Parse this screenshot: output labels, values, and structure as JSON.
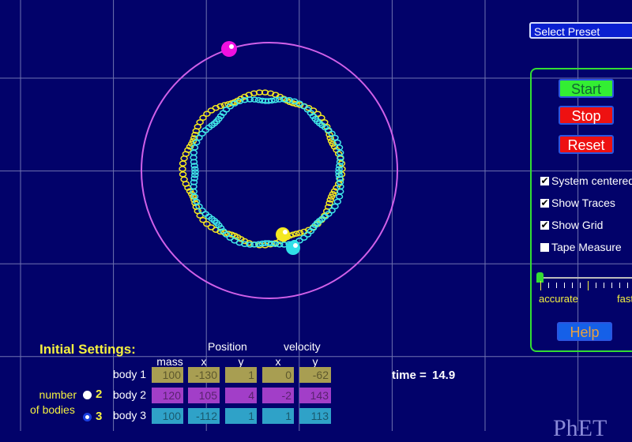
{
  "preset": {
    "label": "Select Preset"
  },
  "controls": {
    "start": "Start",
    "stop": "Stop",
    "reset": "Reset",
    "help": "Help",
    "checkboxes": [
      {
        "label": "System centered",
        "checked": true
      },
      {
        "label": "Show Traces",
        "checked": true
      },
      {
        "label": "Show Grid",
        "checked": true
      },
      {
        "label": "Tape Measure",
        "checked": false
      }
    ],
    "slider": {
      "min_label": "accurate",
      "max_label": "fast",
      "value": 0
    }
  },
  "settings": {
    "title": "Initial Settings:",
    "position": "Position",
    "velocity": "velocity",
    "columns": [
      "mass",
      "x",
      "y",
      "x",
      "y"
    ],
    "bodies": [
      {
        "label": "body 1",
        "values": [
          "100",
          "-130",
          "1",
          "0",
          "-62"
        ],
        "color": "#a89e52"
      },
      {
        "label": "body 2",
        "values": [
          "120",
          "105",
          "4",
          "-2",
          "143"
        ],
        "color": "#a23ec8"
      },
      {
        "label": "body 3",
        "values": [
          "100",
          "-112",
          "1",
          "1",
          "113"
        ],
        "color": "#2fa2c8"
      }
    ],
    "number_label_1": "number",
    "number_label_2": "of bodies",
    "options": [
      "2",
      "3"
    ],
    "selected": "3"
  },
  "time": {
    "label": "time =",
    "value": "14.9"
  },
  "logo": "PhET"
}
